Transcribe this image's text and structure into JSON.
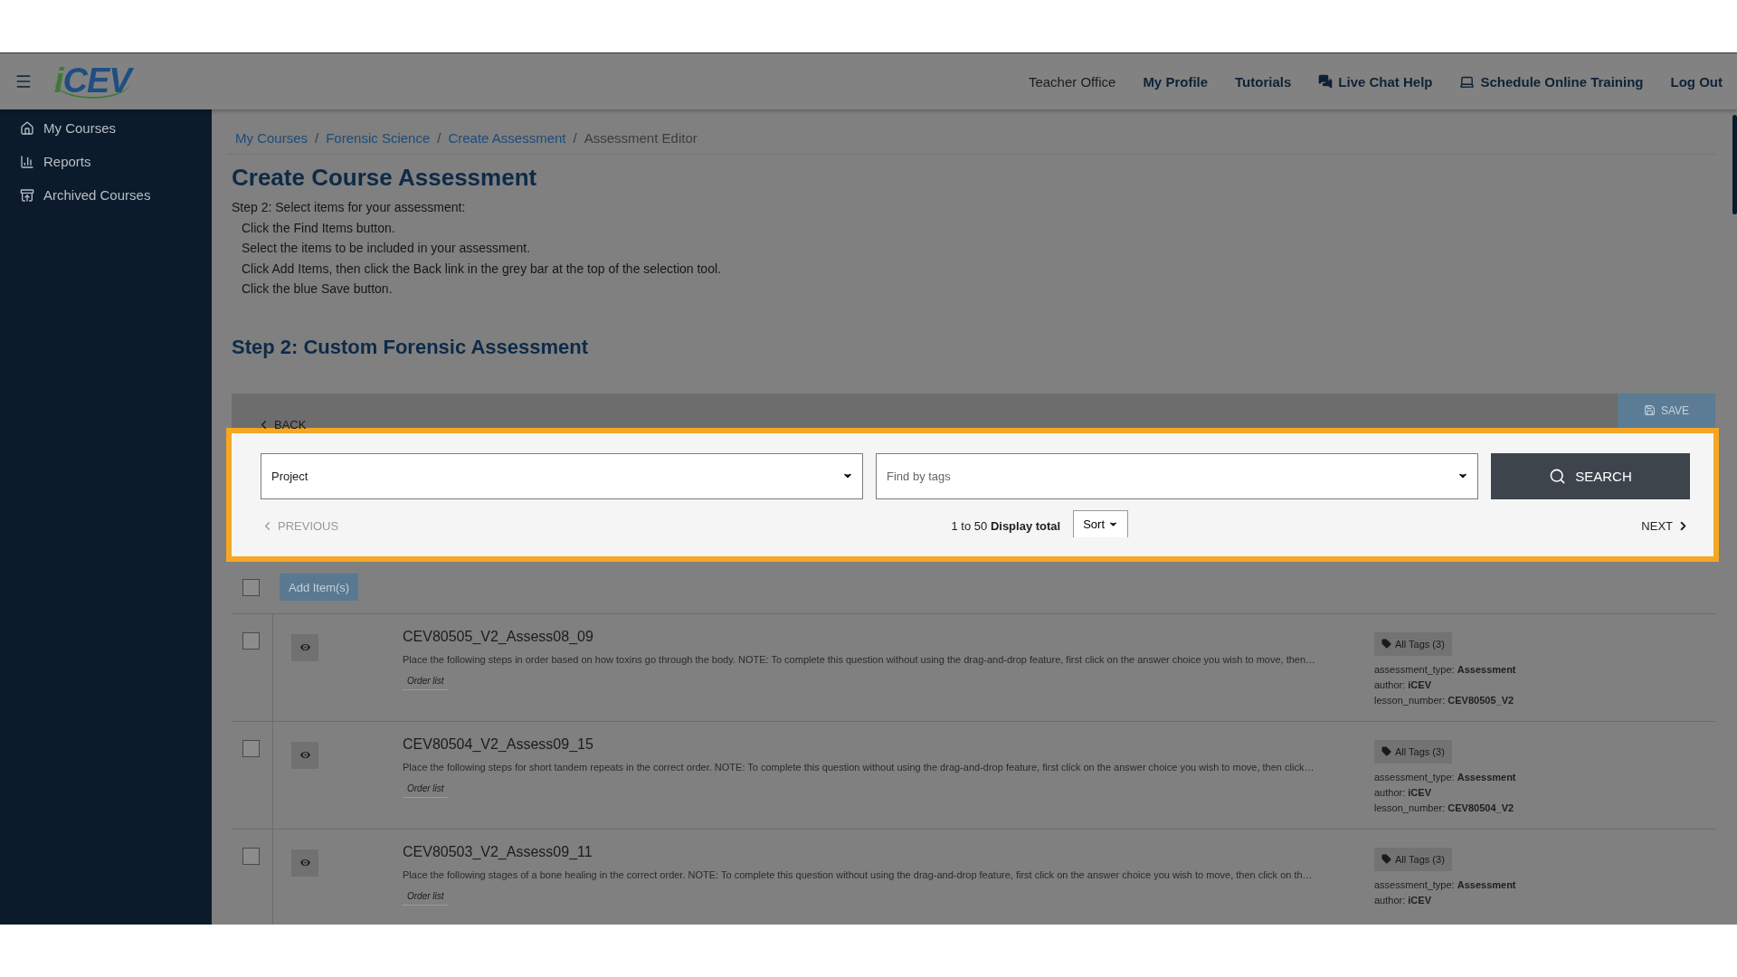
{
  "logo": "iCEV",
  "nav": [
    {
      "label": "Teacher Office",
      "kind": "plain"
    },
    {
      "label": "My Profile",
      "kind": "link"
    },
    {
      "label": "Tutorials",
      "kind": "link"
    },
    {
      "label": "Live Chat Help",
      "kind": "chat"
    },
    {
      "label": "Schedule Online Training",
      "kind": "laptop"
    },
    {
      "label": "Log Out",
      "kind": "link"
    }
  ],
  "sidebar": {
    "items": [
      {
        "label": "My Courses",
        "kind": "home"
      },
      {
        "label": "Reports",
        "kind": "chart"
      },
      {
        "label": "Archived Courses",
        "kind": "archive"
      }
    ]
  },
  "breadcrumb": [
    {
      "label": "My Courses",
      "current": false
    },
    {
      "separator": "/",
      "label": "Forensic Science",
      "current": false
    },
    {
      "separator": "/",
      "label": "Create Assessment",
      "current": false
    },
    {
      "separator": "/",
      "label": "Assessment Editor",
      "current": true
    }
  ],
  "page_title": "Create Course Assessment",
  "instructions": {
    "intro": "Step 2: Select items for your assessment:",
    "steps": [
      "Click the Find Items button.",
      "Select the items to be included in your assessment.",
      "Click Add Items, then click the Back link in the grey bar at the top of the selection tool.",
      "Click the blue Save button."
    ]
  },
  "section_title": "Step 2: Custom Forensic Assessment",
  "selection_tool": {
    "back": "BACK",
    "save": "SAVE",
    "project_select": {
      "value": "Project"
    },
    "tags_select": {
      "placeholder": "Find by tags"
    },
    "search": "SEARCH",
    "previous": {
      "label": "PREVIOUS",
      "disabled": true
    },
    "range": "1 to 50 **Display total**",
    "sort": "Sort",
    "next": {
      "label": "NEXT",
      "disabled": false
    }
  },
  "select_all": {
    "checked": false
  },
  "add_button": "Add Item(s)",
  "items": [
    {
      "checked": false,
      "title": "CEV80505_V2_Assess08_09",
      "description": "Place the following steps in order based on how toxins go through the body. NOTE: To complete this question without using the drag-and-drop feature, first click on the answer choice you wish to move, then…",
      "type": "Order list",
      "tags_button": "All Tags (3)",
      "tags": [
        "assessment_type: **Assessment**",
        "author: **iCEV**",
        "lesson_number: **CEV80505_V2**"
      ]
    },
    {
      "checked": false,
      "title": "CEV80504_V2_Assess09_15",
      "description": "Place the following steps for short tandem repeats in the correct order. NOTE: To complete this question without using the drag-and-drop feature, first click on the answer choice you wish to move, then click…",
      "type": "Order list",
      "tags_button": "All Tags (3)",
      "tags": [
        "assessment_type: **Assessment**",
        "author: **iCEV**",
        "lesson_number: **CEV80504_V2**"
      ]
    },
    {
      "checked": false,
      "title": "CEV80503_V2_Assess09_11",
      "description": "Place the following stages of a bone healing in the correct order. NOTE: To complete this question without using the drag-and-drop feature, first click on the answer choice you wish to move, then click on th…",
      "type": "Order list",
      "tags_button": "All Tags (3)",
      "tags": [
        "assessment_type: **Assessment**",
        "author: **iCEV**"
      ]
    }
  ]
}
